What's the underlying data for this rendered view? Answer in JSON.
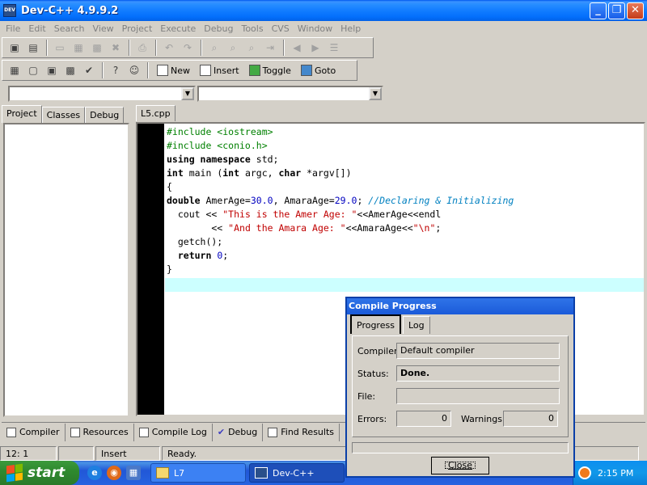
{
  "window": {
    "title": "Dev-C++ 4.9.9.2",
    "app_icon_text": "DEV"
  },
  "menu": [
    "File",
    "Edit",
    "Search",
    "View",
    "Project",
    "Execute",
    "Debug",
    "Tools",
    "CVS",
    "Window",
    "Help"
  ],
  "toolbar2": {
    "new_label": "New",
    "insert_label": "Insert",
    "toggle_label": "Toggle",
    "goto_label": "Goto"
  },
  "left_tabs": [
    "Project",
    "Classes",
    "Debug"
  ],
  "editor": {
    "tab_label": "L5.cpp",
    "lines": [
      "#include <iostream>",
      "#include <conio.h>",
      "using namespace std;",
      "int main (int argc, char *argv[])",
      "{",
      "double AmerAge=30.0, AmaraAge=29.0; //Declaring & Initializing",
      "  cout << \"This is the Amer Age: \"<<AmerAge<<endl",
      "        << \"And the Amara Age: \"<<AmaraAge<<\"\\n\";",
      "  getch();",
      "  return 0;",
      "}"
    ]
  },
  "bottom_tabs": [
    "Compiler",
    "Resources",
    "Compile Log",
    "Debug",
    "Find Results"
  ],
  "status": {
    "position": "12: 1",
    "mode": "Insert",
    "message": "Ready."
  },
  "dialog": {
    "title": "Compile Progress",
    "tabs": [
      "Progress",
      "Log"
    ],
    "compiler_label": "Compiler:",
    "compiler_value": "Default compiler",
    "status_label": "Status:",
    "status_value": "Done.",
    "file_label": "File:",
    "file_value": "",
    "errors_label": "Errors:",
    "errors_value": "0",
    "warnings_label": "Warnings:",
    "warnings_value": "0",
    "progress": 0,
    "close_label": "Close"
  },
  "taskbar": {
    "start_label": "start",
    "tasks": [
      "L7",
      "Dev-C++"
    ],
    "clock": "2:15 PM"
  }
}
